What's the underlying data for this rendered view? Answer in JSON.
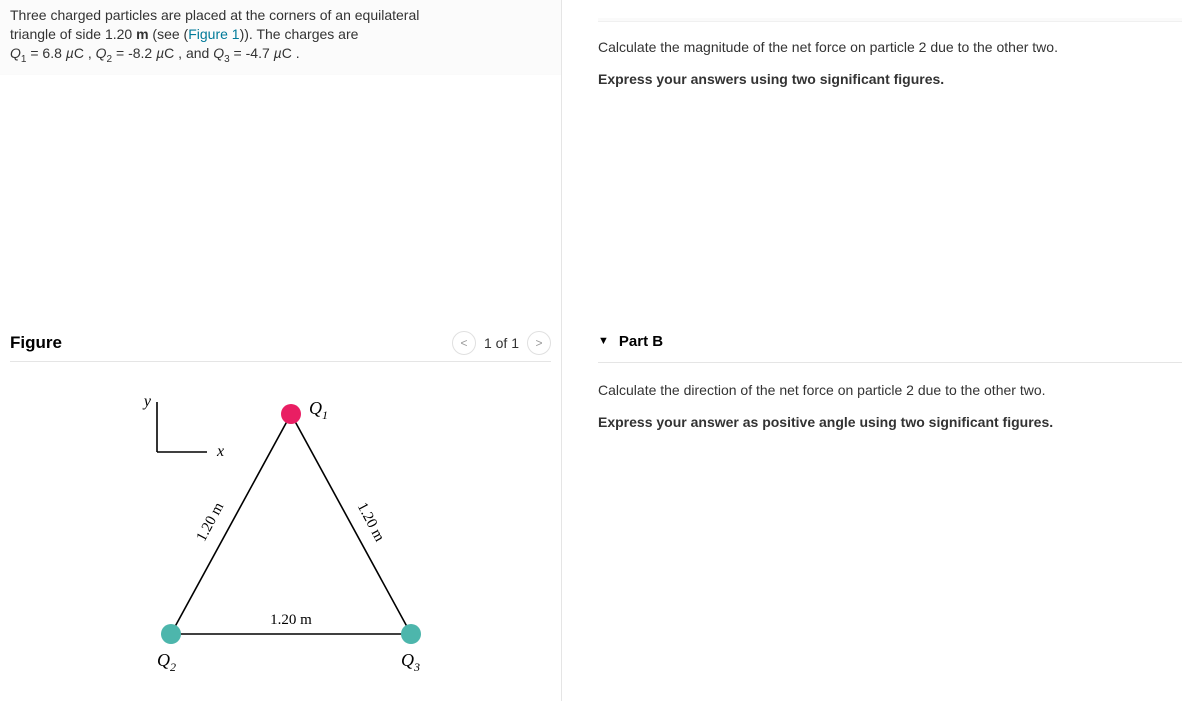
{
  "problem": {
    "line1_a": "Three charged particles are placed at the corners of an equilateral",
    "line2_a": "triangle of side 1.20 ",
    "unit_m": "m",
    "line2_b": " (see (",
    "figlink": "Figure 1",
    "line2_c": ")). The charges are",
    "q1var": "Q",
    "s1": "1",
    "eq": " = ",
    "q1val": "6.8 ",
    "mu": "µ",
    "ccap": "C",
    "comma": " , ",
    "q2var": "Q",
    "s2": "2",
    "q2val": "-8.2 ",
    "and": " , and ",
    "q3var": "Q",
    "s3": "3",
    "q3val": "-4.7 ",
    "period": " ."
  },
  "figure": {
    "title": "Figure",
    "count": "1 of 1",
    "prev_icon": "<",
    "next_icon": ">",
    "labels": {
      "y": "y",
      "x": "x",
      "q1": "Q",
      "q2": "Q",
      "q3": "Q",
      "s1": "1",
      "s2": "2",
      "s3": "3",
      "side": "1.20 m"
    }
  },
  "partA": {
    "prompt": "Calculate the magnitude of the net force on particle 2 due to the other two.",
    "hint": "Express your answers using two significant figures."
  },
  "partB": {
    "header": "Part B",
    "caret": "▼",
    "prompt": "Calculate the direction of the net force on particle 2 due to the other two.",
    "hint": "Express your answer as positive angle using two significant figures."
  },
  "chart_data": {
    "type": "diagram",
    "shape": "equilateral-triangle",
    "side_length_m": 1.2,
    "vertices": [
      {
        "label": "Q1",
        "position": "top",
        "charge_uC": 6.8,
        "color": "#e91e63"
      },
      {
        "label": "Q2",
        "position": "bottom-left",
        "charge_uC": -8.2,
        "color": "#4db6ac"
      },
      {
        "label": "Q3",
        "position": "bottom-right",
        "charge_uC": -4.7,
        "color": "#4db6ac"
      }
    ],
    "axes_inset": {
      "x": "x",
      "y": "y"
    }
  }
}
